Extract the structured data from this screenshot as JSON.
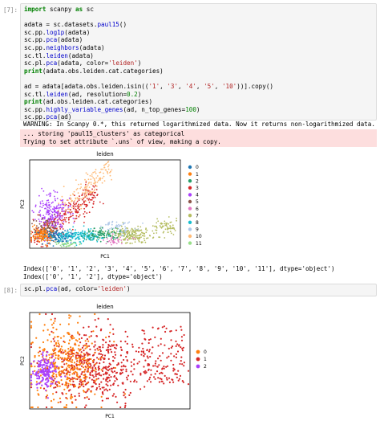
{
  "cell1": {
    "prompt": "[7]:",
    "lines": [
      [
        {
          "t": "import",
          "c": "kw"
        },
        {
          "t": " scanpy "
        },
        {
          "t": "as",
          "c": "kw"
        },
        {
          "t": " sc"
        }
      ],
      [],
      [
        {
          "t": "adata = sc.datasets."
        },
        {
          "t": "paul15",
          "c": "fn"
        },
        {
          "t": "()"
        }
      ],
      [
        {
          "t": "sc.pp."
        },
        {
          "t": "log1p",
          "c": "fn"
        },
        {
          "t": "(adata)"
        }
      ],
      [
        {
          "t": "sc.pp."
        },
        {
          "t": "pca",
          "c": "fn"
        },
        {
          "t": "(adata)"
        }
      ],
      [
        {
          "t": "sc.pp."
        },
        {
          "t": "neighbors",
          "c": "fn"
        },
        {
          "t": "(adata)"
        }
      ],
      [
        {
          "t": "sc.tl."
        },
        {
          "t": "leiden",
          "c": "fn"
        },
        {
          "t": "(adata)"
        }
      ],
      [
        {
          "t": "sc.pl."
        },
        {
          "t": "pca",
          "c": "fn"
        },
        {
          "t": "(adata, color="
        },
        {
          "t": "'leiden'",
          "c": "str"
        },
        {
          "t": ")"
        }
      ],
      [
        {
          "t": "print",
          "c": "kw"
        },
        {
          "t": "(adata.obs.leiden.cat.categories)"
        }
      ],
      [],
      [
        {
          "t": "ad = adata[adata.obs.leiden.isin(("
        },
        {
          "t": "'1'",
          "c": "str"
        },
        {
          "t": ", "
        },
        {
          "t": "'3'",
          "c": "str"
        },
        {
          "t": ", "
        },
        {
          "t": "'4'",
          "c": "str"
        },
        {
          "t": ", "
        },
        {
          "t": "'5'",
          "c": "str"
        },
        {
          "t": ", "
        },
        {
          "t": "'10'",
          "c": "str"
        },
        {
          "t": "))].copy()"
        }
      ],
      [
        {
          "t": "sc.tl."
        },
        {
          "t": "leiden",
          "c": "fn"
        },
        {
          "t": "(ad, resolution="
        },
        {
          "t": "0.2",
          "c": "num"
        },
        {
          "t": ")"
        }
      ],
      [
        {
          "t": "print",
          "c": "kw"
        },
        {
          "t": "(ad.obs.leiden.cat.categories)"
        }
      ],
      [
        {
          "t": "sc.pp."
        },
        {
          "t": "highly_variable_genes",
          "c": "fn"
        },
        {
          "t": "(ad, n_top_genes="
        },
        {
          "t": "100",
          "c": "num"
        },
        {
          "t": ")"
        }
      ],
      [
        {
          "t": "sc.pp."
        },
        {
          "t": "pca",
          "c": "fn"
        },
        {
          "t": "(ad)"
        }
      ]
    ]
  },
  "warning": "WARNING: In Scanpy 0.*, this returned logarithmized data. Now it returns non-logarithmized data.",
  "stderr": [
    "... storing 'paul15_clusters' as categorical",
    "Trying to set attribute `.uns` of view, making a copy."
  ],
  "index_out": [
    "Index(['0', '1', '2', '3', '4', '5', '6', '7', '8', '9', '10', '11'], dtype='object')",
    "Index(['0', '1', '2'], dtype='object')"
  ],
  "cell2": {
    "prompt": "[8]:",
    "lines": [
      [
        {
          "t": "sc.pl."
        },
        {
          "t": "pca",
          "c": "fn"
        },
        {
          "t": "(ad, color="
        },
        {
          "t": "'leiden'",
          "c": "str"
        },
        {
          "t": ")"
        }
      ]
    ]
  },
  "chart_data": [
    {
      "type": "scatter",
      "title": "leiden",
      "xlabel": "PC1",
      "ylabel": "PC2",
      "legend_position": "right",
      "series": [
        {
          "name": "0",
          "color": "#1f77b4"
        },
        {
          "name": "1",
          "color": "#ff7f0e"
        },
        {
          "name": "2",
          "color": "#279e68"
        },
        {
          "name": "3",
          "color": "#d62728"
        },
        {
          "name": "4",
          "color": "#aa40fc"
        },
        {
          "name": "5",
          "color": "#8c564b"
        },
        {
          "name": "6",
          "color": "#e377c2"
        },
        {
          "name": "7",
          "color": "#b5bd61"
        },
        {
          "name": "8",
          "color": "#17becf"
        },
        {
          "name": "9",
          "color": "#aec7e8"
        },
        {
          "name": "10",
          "color": "#ffbb78"
        },
        {
          "name": "11",
          "color": "#98df8a"
        }
      ]
    },
    {
      "type": "scatter",
      "title": "leiden",
      "xlabel": "PC1",
      "ylabel": "PC2",
      "legend_position": "right",
      "series": [
        {
          "name": "0",
          "color": "#ff7f0e"
        },
        {
          "name": "1",
          "color": "#d62728"
        },
        {
          "name": "2",
          "color": "#aa40fc"
        }
      ]
    }
  ]
}
